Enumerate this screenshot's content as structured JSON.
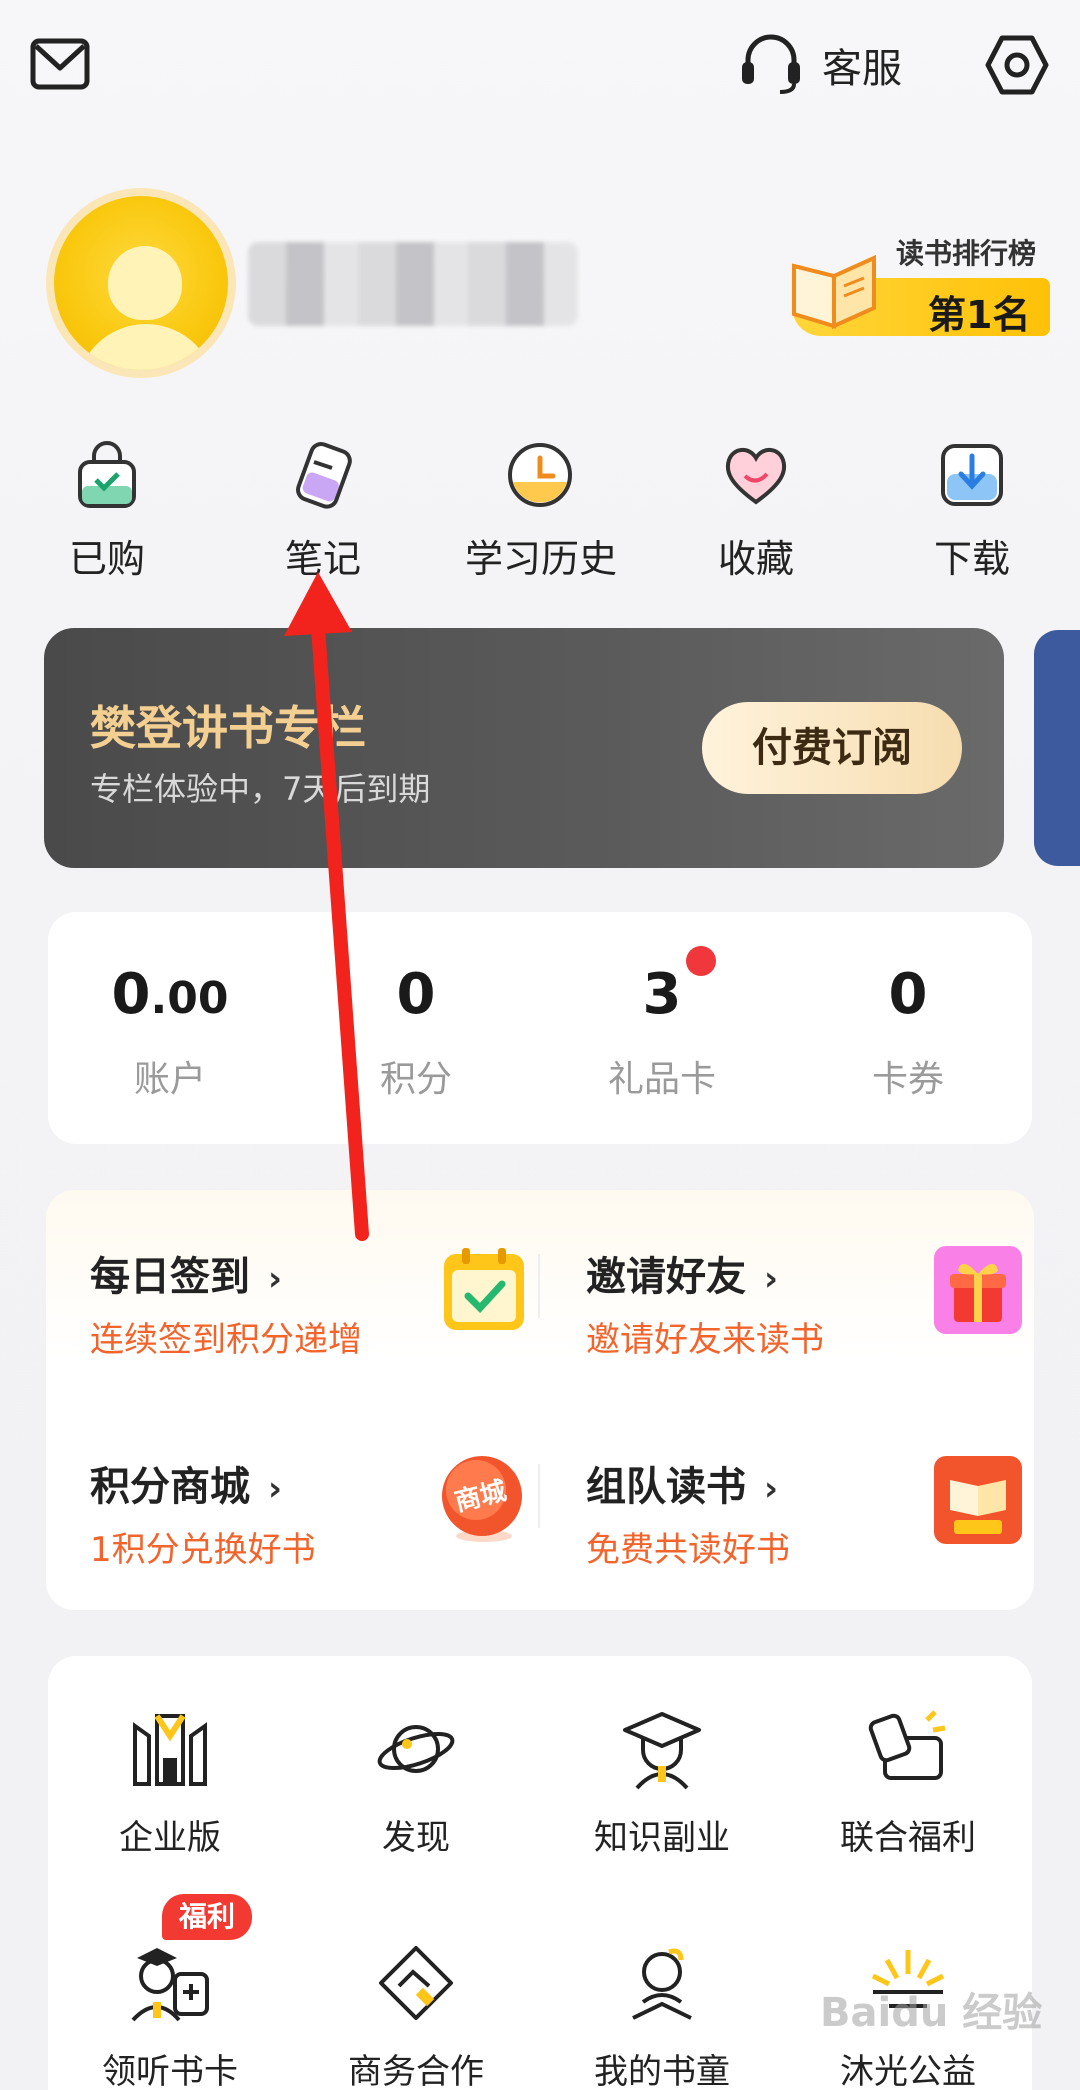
{
  "topbar": {
    "service_label": "客服"
  },
  "profile": {
    "rank_title": "读书排行榜",
    "rank_value": "第1名"
  },
  "quick_actions": [
    {
      "label": "已购",
      "icon": "shopping-bag-icon"
    },
    {
      "label": "笔记",
      "icon": "note-pen-icon"
    },
    {
      "label": "学习历史",
      "icon": "clock-icon"
    },
    {
      "label": "收藏",
      "icon": "heart-icon"
    },
    {
      "label": "下载",
      "icon": "download-icon"
    }
  ],
  "column": {
    "title": "樊登讲书专栏",
    "subtitle": "专栏体验中，7天后到期",
    "button_label": "付费订阅"
  },
  "stats": [
    {
      "value_int": "0",
      "value_dec": ".00",
      "label": "账户"
    },
    {
      "value_int": "0",
      "value_dec": "",
      "label": "积分"
    },
    {
      "value_int": "3",
      "value_dec": "",
      "label": "礼品卡"
    },
    {
      "value_int": "0",
      "value_dec": "",
      "label": "卡券"
    }
  ],
  "tasks": [
    {
      "title": "每日签到",
      "subtitle": "连续签到积分递增",
      "icon": "calendar-check-icon"
    },
    {
      "title": "邀请好友",
      "subtitle": "邀请好友来读书",
      "icon": "gift-box-icon"
    },
    {
      "title": "积分商城",
      "subtitle": "1积分兑换好书",
      "icon": "mall-badge-icon",
      "badge_text": "商城"
    },
    {
      "title": "组队读书",
      "subtitle": "免费共读好书",
      "icon": "book-stand-icon"
    }
  ],
  "services": [
    {
      "label": "企业版",
      "icon": "enterprise-icon"
    },
    {
      "label": "发现",
      "icon": "planet-icon"
    },
    {
      "label": "知识副业",
      "icon": "graduate-icon"
    },
    {
      "label": "联合福利",
      "icon": "coupon-icon"
    },
    {
      "label": "领听书卡",
      "icon": "doctor-card-icon"
    },
    {
      "label": "商务合作",
      "icon": "handshake-icon"
    },
    {
      "label": "我的书童",
      "icon": "reader-icon"
    },
    {
      "label": "沐光公益",
      "icon": "sunrise-icon"
    }
  ],
  "welfare_badge": "福利",
  "watermark": "Baidu 经验",
  "colors": {
    "accent_orange": "#f2642c",
    "gold": "#f3cf92",
    "yellow": "#ffc107",
    "red": "#f0383c"
  }
}
